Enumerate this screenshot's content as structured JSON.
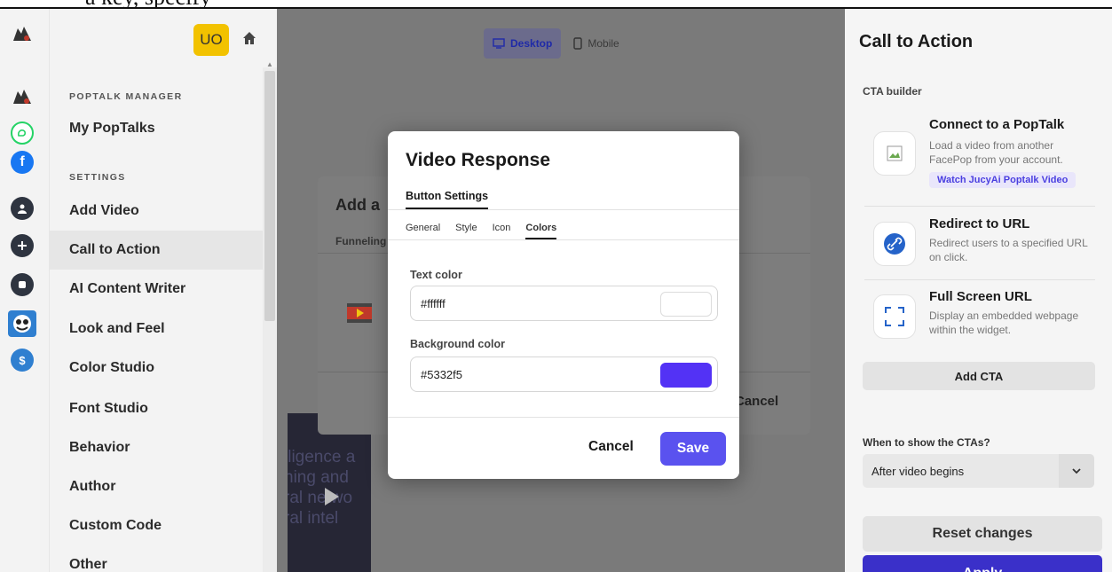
{
  "top_strip": {
    "text": "a key, specify"
  },
  "rail": {
    "icons": [
      {
        "name": "poptalk-logo-icon",
        "color": "#333333"
      },
      {
        "name": "whatsapp-icon",
        "color": "#25d366"
      },
      {
        "name": "facebook-icon",
        "color": "#1877f2"
      },
      {
        "name": "user-circle-icon",
        "color": "#2e3440"
      },
      {
        "name": "add-circle-icon",
        "color": "#2e3440"
      },
      {
        "name": "app-circle-icon",
        "color": "#2e3440"
      },
      {
        "name": "mascot-icon",
        "color": "#2f7fd0"
      },
      {
        "name": "dollar-circle-icon",
        "color": "#2f7fd0"
      }
    ]
  },
  "sidebar": {
    "avatar_initials": "UO",
    "section_manager": "POPTALK MANAGER",
    "my_poptalks": "My PopTalks",
    "section_settings": "SETTINGS",
    "items": [
      {
        "label": "Add Video"
      },
      {
        "label": "Call to Action"
      },
      {
        "label": "AI Content Writer"
      },
      {
        "label": "Look and Feel"
      },
      {
        "label": "Color Studio"
      },
      {
        "label": "Font Studio"
      },
      {
        "label": "Behavior"
      },
      {
        "label": "Author"
      },
      {
        "label": "Custom Code"
      },
      {
        "label": "Other"
      }
    ]
  },
  "preview": {
    "desktop_label": "Desktop",
    "mobile_label": "Mobile",
    "video_text_lines": [
      "lligence a",
      "ning and",
      "ral netwo",
      "ral intel"
    ]
  },
  "back_dialog": {
    "title": "Add a",
    "tab": "Funneling",
    "cancel": "Cancel"
  },
  "modal": {
    "title": "Video Response",
    "subtab": "Button Settings",
    "tabs": [
      {
        "label": "General"
      },
      {
        "label": "Style"
      },
      {
        "label": "Icon"
      },
      {
        "label": "Colors"
      }
    ],
    "text_color_label": "Text color",
    "text_color_value": "#ffffff",
    "background_color_label": "Background color",
    "background_color_value": "#5332f5",
    "cancel_label": "Cancel",
    "save_label": "Save",
    "accent": "#5a52ef"
  },
  "right_panel": {
    "title": "Call to Action",
    "section": "CTA builder",
    "ctas": [
      {
        "title": "Connect to a PopTalk",
        "desc": "Load a video from another FacePop from your account.",
        "link": "Watch JucyAi Poptalk Video"
      },
      {
        "title": "Redirect to URL",
        "desc": "Redirect users to a specified URL on click."
      },
      {
        "title": "Full Screen URL",
        "desc": "Display an embedded webpage within the widget."
      }
    ],
    "add_cta": "Add CTA",
    "when_label": "When to show the CTAs?",
    "when_value": "After video begins",
    "reset": "Reset changes",
    "apply": "Apply"
  }
}
